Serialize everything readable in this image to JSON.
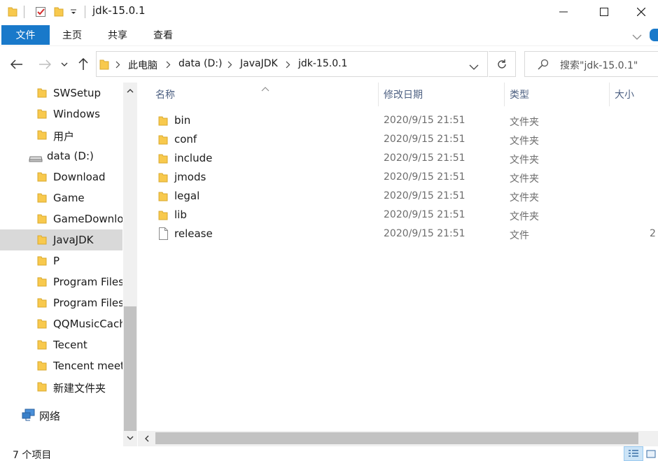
{
  "window": {
    "title": "jdk-15.0.1",
    "minimize_label": "—",
    "maximize_label": "☐",
    "close_label": "✕"
  },
  "ribbon": {
    "tabs": [
      "文件",
      "主页",
      "共享",
      "查看"
    ]
  },
  "address": {
    "crumbs": [
      "此电脑",
      "data (D:)",
      "JavaJDK",
      "jdk-15.0.1"
    ]
  },
  "search": {
    "placeholder": "搜索\"jdk-15.0.1\""
  },
  "nav": {
    "items": [
      {
        "label": "SWSetup",
        "kind": "folder"
      },
      {
        "label": "Windows",
        "kind": "folder"
      },
      {
        "label": "用户",
        "kind": "folder"
      },
      {
        "label": "data (D:)",
        "kind": "drive"
      },
      {
        "label": "Download",
        "kind": "folder"
      },
      {
        "label": "Game",
        "kind": "folder"
      },
      {
        "label": "GameDownload",
        "kind": "folder"
      },
      {
        "label": "JavaJDK",
        "kind": "folder",
        "selected": true
      },
      {
        "label": "P",
        "kind": "folder"
      },
      {
        "label": "Program Files",
        "kind": "folder"
      },
      {
        "label": "Program Files",
        "kind": "folder"
      },
      {
        "label": "QQMusicCache",
        "kind": "folder"
      },
      {
        "label": "Tecent",
        "kind": "folder"
      },
      {
        "label": "Tencent meeting",
        "kind": "folder"
      },
      {
        "label": "新建文件夹",
        "kind": "folder"
      },
      {
        "label": "网络",
        "kind": "network"
      }
    ]
  },
  "columns": {
    "name": "名称",
    "date": "修改日期",
    "type": "类型",
    "size": "大小"
  },
  "files": [
    {
      "name": "bin",
      "date": "2020/9/15 21:51",
      "type": "文件夹",
      "size": "",
      "kind": "folder"
    },
    {
      "name": "conf",
      "date": "2020/9/15 21:51",
      "type": "文件夹",
      "size": "",
      "kind": "folder"
    },
    {
      "name": "include",
      "date": "2020/9/15 21:51",
      "type": "文件夹",
      "size": "",
      "kind": "folder"
    },
    {
      "name": "jmods",
      "date": "2020/9/15 21:51",
      "type": "文件夹",
      "size": "",
      "kind": "folder"
    },
    {
      "name": "legal",
      "date": "2020/9/15 21:51",
      "type": "文件夹",
      "size": "",
      "kind": "folder"
    },
    {
      "name": "lib",
      "date": "2020/9/15 21:51",
      "type": "文件夹",
      "size": "",
      "kind": "folder"
    },
    {
      "name": "release",
      "date": "2020/9/15 21:51",
      "type": "文件",
      "size": "2",
      "kind": "file"
    }
  ],
  "status": {
    "count": "7 个项目"
  },
  "colors": {
    "accent": "#1979ca",
    "folder": "#f8c94d",
    "selected": "#d9d9d9"
  }
}
